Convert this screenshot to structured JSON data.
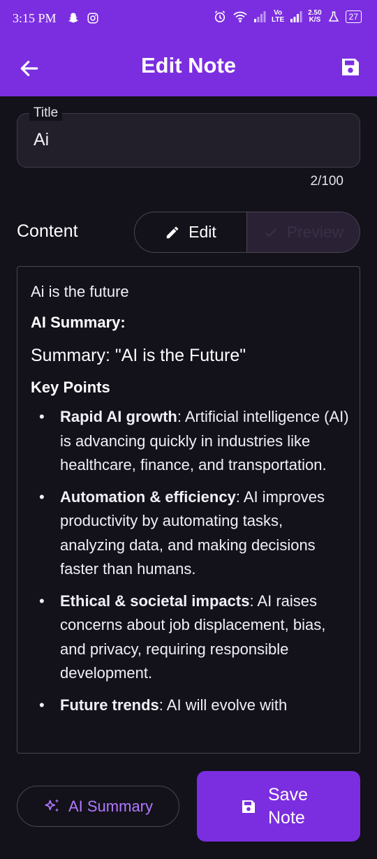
{
  "status": {
    "time": "3:15 PM",
    "net_speed_top": "2.50",
    "net_speed_bottom": "K/S",
    "battery": "27",
    "vo": "Vo",
    "lte": "LTE"
  },
  "appbar": {
    "title": "Edit Note"
  },
  "title_field": {
    "label": "Title",
    "value": "Ai",
    "counter": "2/100"
  },
  "content": {
    "label": "Content",
    "edit_label": "Edit",
    "preview_label": "Preview"
  },
  "preview": {
    "line1": "Ai is the future",
    "ai_summary_heading": "AI Summary:",
    "summary_heading": "Summary: \"AI is the Future\"",
    "key_points_heading": "Key Points",
    "points": [
      {
        "bold": "Rapid AI growth",
        "text": ": Artificial intelligence (AI) is advancing quickly in industries like healthcare, finance, and transportation."
      },
      {
        "bold": "Automation & efficiency",
        "text": ": AI improves productivity by automating tasks, analyzing data, and making decisions faster than humans."
      },
      {
        "bold": "Ethical & societal impacts",
        "text": ": AI raises concerns about job displacement, bias, and privacy, requiring responsible development."
      },
      {
        "bold": "Future trends",
        "text": ": AI will evolve with"
      }
    ]
  },
  "buttons": {
    "ai_summary": "AI Summary",
    "save_line1": "Save",
    "save_line2": "Note"
  },
  "colors": {
    "primary": "#7b2ee0",
    "background": "#13111a",
    "accent_text": "#b07aff"
  }
}
